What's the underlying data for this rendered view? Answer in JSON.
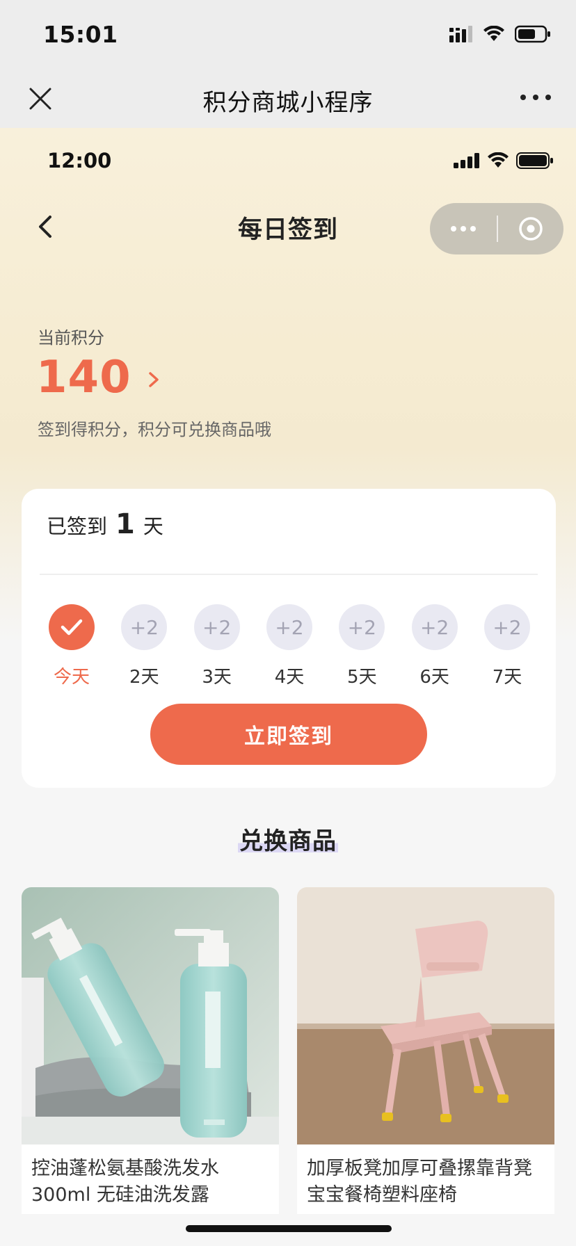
{
  "outer_status": {
    "time": "15:01"
  },
  "outer_nav": {
    "title": "积分商城小程序"
  },
  "inner_status": {
    "time": "12:00"
  },
  "page": {
    "title": "每日签到"
  },
  "points": {
    "label": "当前积分",
    "value": "140",
    "hint": "签到得积分，积分可兑换商品哦"
  },
  "checkin": {
    "prefix": "已签到",
    "days": "1",
    "suffix": "天",
    "items": [
      {
        "reward": "",
        "label": "今天",
        "done": true
      },
      {
        "reward": "+2",
        "label": "2天",
        "done": false
      },
      {
        "reward": "+2",
        "label": "3天",
        "done": false
      },
      {
        "reward": "+2",
        "label": "4天",
        "done": false
      },
      {
        "reward": "+2",
        "label": "5天",
        "done": false
      },
      {
        "reward": "+2",
        "label": "6天",
        "done": false
      },
      {
        "reward": "+2",
        "label": "7天",
        "done": false
      }
    ],
    "button": "立即签到"
  },
  "exchange": {
    "title": "兑换商品",
    "products": [
      {
        "name": "控油蓬松氨基酸洗发水300ml 无硅油洗发露"
      },
      {
        "name": "加厚板凳加厚可叠摞靠背凳宝宝餐椅塑料座椅"
      }
    ]
  },
  "colors": {
    "accent": "#ee6a4c",
    "header_gradient_top": "#f8f0db",
    "pending_circle": "#e9e9f2"
  }
}
